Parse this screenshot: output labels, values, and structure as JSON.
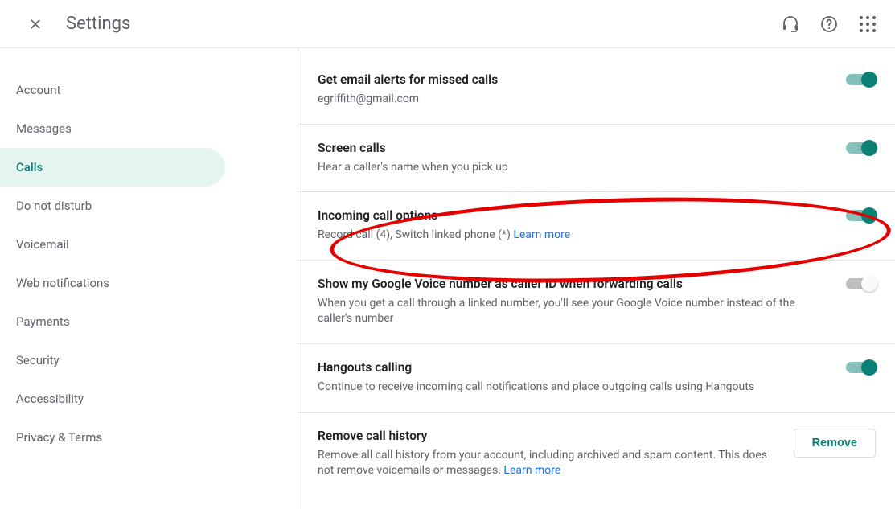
{
  "header": {
    "title": "Settings"
  },
  "sidebar": {
    "items": [
      {
        "label": "Account",
        "active": false
      },
      {
        "label": "Messages",
        "active": false
      },
      {
        "label": "Calls",
        "active": true
      },
      {
        "label": "Do not disturb",
        "active": false
      },
      {
        "label": "Voicemail",
        "active": false
      },
      {
        "label": "Web notifications",
        "active": false
      },
      {
        "label": "Payments",
        "active": false
      },
      {
        "label": "Security",
        "active": false
      },
      {
        "label": "Accessibility",
        "active": false
      },
      {
        "label": "Privacy & Terms",
        "active": false
      }
    ]
  },
  "settings": {
    "email_alerts": {
      "title": "Get email alerts for missed calls",
      "desc": "egriffith@gmail.com",
      "toggle": true
    },
    "screen_calls": {
      "title": "Screen calls",
      "desc": "Hear a caller's name when you pick up",
      "toggle": true
    },
    "incoming_options": {
      "title": "Incoming call options",
      "desc_prefix": "Record call (4), Switch linked phone (*) ",
      "learn_more": "Learn more",
      "toggle": true
    },
    "caller_id": {
      "title": "Show my Google Voice number as caller ID when forwarding calls",
      "desc": "When you get a call through a linked number, you'll see your Google Voice number instead of the caller's number",
      "toggle": false
    },
    "hangouts": {
      "title": "Hangouts calling",
      "desc": "Continue to receive incoming call notifications and place outgoing calls using Hangouts",
      "toggle": true
    },
    "remove_history": {
      "title": "Remove call history",
      "desc_prefix": "Remove all call history from your account, including archived and spam content. This does not remove voicemails or messages. ",
      "learn_more": "Learn more",
      "button": "Remove"
    }
  }
}
